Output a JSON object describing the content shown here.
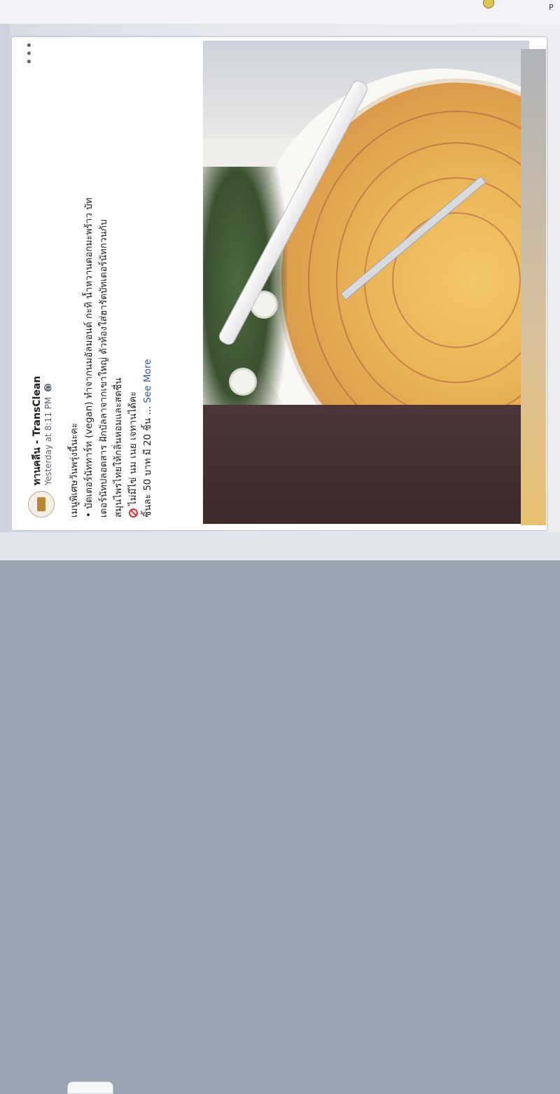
{
  "page": {
    "top_corner_text": "P",
    "name": "ทานคลีน - TransClean",
    "timestamp": "Yesterday at 8:11 PM",
    "privacy_icon": "globe-icon",
    "more_icon": "ellipsis-icon"
  },
  "post": {
    "line1": "เมนูพิเศษวันพรุ่งนี้นะคะ",
    "line2": "• บัตเตอร์นัททาร์ท (vegan) ทำจากนมอัลมอนด์ กะทิ น้ำหวานดอกมะพร้าว บัท",
    "line3": "เตอร์นัทปลอดสาร ฝักบัลลาจากเขาใหญ่ ตัวท้องใส่ฮารัตบัทเตอร์นัทกวนกับ",
    "line4": "สมุนไพรไทยให้กลิ่นหอมและสดชื่น",
    "line5": "ไม่มีไข่ นม เนย เจทานได้คะ",
    "line6_prefix": "ชิ้นละ 50 บาท มี 20 ชิ้น ...",
    "see_more": "See More"
  },
  "icons": {
    "no_symbol": "prohibited-icon"
  },
  "colors": {
    "link": "#385898",
    "text": "#1c1e21",
    "meta": "#606770",
    "prohibited": "#dd3333"
  }
}
